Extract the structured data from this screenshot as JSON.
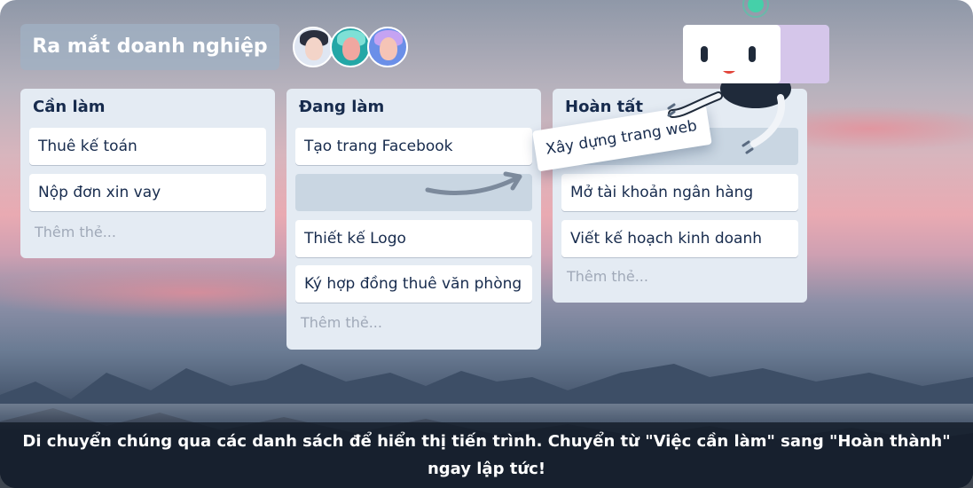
{
  "board": {
    "title": "Ra mắt doanh nghiệp",
    "members": [
      "member-avatar",
      "member-avatar",
      "member-avatar"
    ]
  },
  "lists": [
    {
      "title": "Cần làm",
      "cards": [
        "Thuê kế toán",
        "Nộp đơn xin vay"
      ],
      "add_label": "Thêm thẻ..."
    },
    {
      "title": "Đang làm",
      "cards": [
        "Tạo trang Facebook",
        "",
        "Thiết kế Logo",
        "Ký hợp đồng thuê văn phòng"
      ],
      "add_label": "Thêm thẻ..."
    },
    {
      "title": "Hoàn tất",
      "cards": [
        "",
        "Mở tài khoản ngân hàng",
        "Viết kế hoạch kinh doanh"
      ],
      "add_label": "Thêm thẻ..."
    }
  ],
  "dragging_card": "Xây dựng trang web",
  "caption": "Di chuyển chúng qua các danh sách để hiển thị tiến trình. Chuyển từ \"Việc cần làm\" sang \"Hoàn thành\" ngay lập tức!",
  "colors": {
    "list_bg": "#e4ebf3",
    "card_text": "#172b4d",
    "placeholder": "#c9d6e2"
  }
}
